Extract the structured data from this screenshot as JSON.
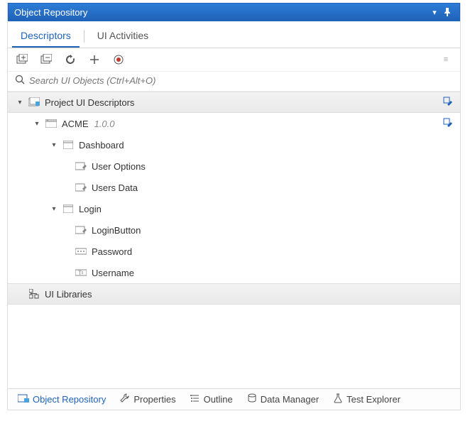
{
  "title": "Object Repository",
  "tabs": {
    "descriptors": "Descriptors",
    "uiActivities": "UI Activities"
  },
  "search": {
    "placeholder": "Search UI Objects (Ctrl+Alt+O)"
  },
  "tree": {
    "root": "Project UI Descriptors",
    "app": {
      "name": "ACME",
      "version": "1.0.0"
    },
    "screens": {
      "dashboard": {
        "name": "Dashboard",
        "items": {
          "userOptions": "User Options",
          "usersData": "Users Data"
        }
      },
      "login": {
        "name": "Login",
        "items": {
          "loginButton": "LoginButton",
          "password": "Password",
          "username": "Username"
        }
      }
    },
    "libraries": "UI Libraries"
  },
  "footer": {
    "objectRepository": "Object Repository",
    "properties": "Properties",
    "outline": "Outline",
    "dataManager": "Data Manager",
    "testExplorer": "Test Explorer"
  }
}
